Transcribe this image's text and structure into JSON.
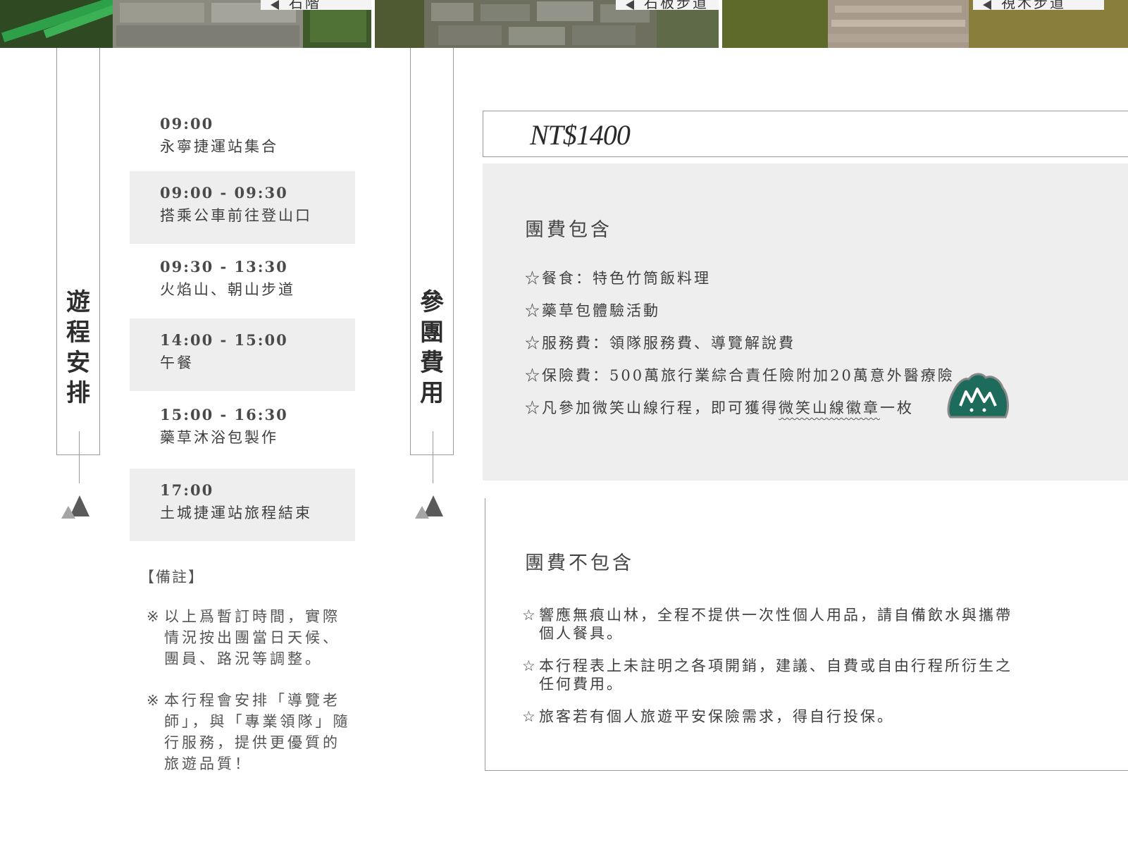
{
  "photos": [
    {
      "caption": "石階"
    },
    {
      "caption": "石板步道"
    },
    {
      "caption": "視木步道"
    }
  ],
  "itinerary": {
    "heading": "遊程安排",
    "schedule": [
      {
        "time": "09:00",
        "desc": "永寧捷運站集合"
      },
      {
        "time": "09:00 - 09:30",
        "desc": "搭乘公車前往登山口"
      },
      {
        "time": "09:30 - 13:30",
        "desc": "火焰山、朝山步道"
      },
      {
        "time": "14:00 - 15:00",
        "desc": "午餐"
      },
      {
        "time": "15:00 - 16:30",
        "desc": "藥草沐浴包製作"
      },
      {
        "time": "17:00",
        "desc": "土城捷運站旅程結束"
      }
    ],
    "notes_title": "【備註】",
    "notes": [
      {
        "mark": "※",
        "text": "以上爲暫訂時間，實際情況按出團當日天候、團員、路況等調整。"
      },
      {
        "mark": "※",
        "text": "本行程會安排「導覽老師」，與「專業領隊」隨行服務，提供更優質的旅遊品質！"
      }
    ]
  },
  "fees": {
    "heading": "參團費用",
    "price": "NT$1400",
    "included_title": "團費包含",
    "included": [
      "☆餐食：特色竹筒飯料理",
      "☆藥草包體驗活動",
      "☆服務費：領隊服務費、導覽解說費",
      "☆保險費：500萬旅行業綜合責任險附加20萬意外醫療險"
    ],
    "badge_line": {
      "before": "☆凡參加微笑山線行程，即可獲得",
      "highlight": "微笑山線徽章",
      "after": "一枚"
    },
    "excluded_title": "團費不包含",
    "excluded": [
      "響應無痕山林，全程不提供一次性個人用品，請自備飲水與攜帶個人餐具。",
      "本行程表上未註明之各項開銷，建議、自費或自由行程所衍生之任何費用。",
      "旅客若有個人旅遊平安保險需求，得自行投保。"
    ],
    "excluded_mark": "☆"
  },
  "colors": {
    "panel_gray": "#eeeeee",
    "border_gray": "#9a9a9a",
    "badge_green": "#1d6b5b"
  },
  "icons": [
    "mountain-triangle-icon",
    "smile-mountain-badge-icon"
  ]
}
